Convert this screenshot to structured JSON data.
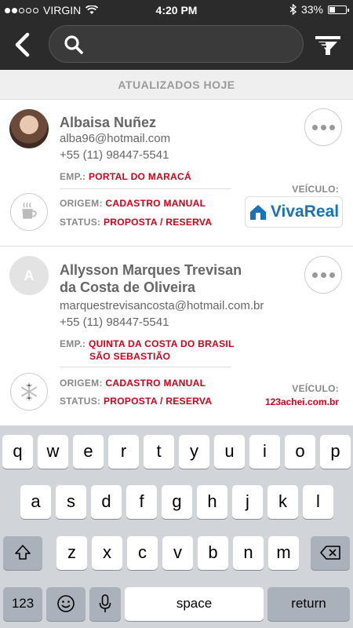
{
  "status_bar": {
    "carrier": "VIRGIN",
    "time": "4:20 PM",
    "battery": "33%",
    "battery_level": 0.33
  },
  "nav": {
    "search_placeholder": "",
    "search_value": ""
  },
  "section_title": "ATUALIZADOS HOJE",
  "leads": [
    {
      "name_line1": "Albaisa Nuñez",
      "name_line2": "",
      "email": "alba96@hotmail.com",
      "phone": "+55 (11) 98447-5541",
      "emp_label": "EMP.:",
      "emp_value_line1": "PORTAL DO MARACÁ",
      "emp_value_line2": "",
      "origem_label": "ORIGEM:",
      "origem_value": "CADASTRO MANUAL",
      "status_label": "STATUS:",
      "status_value": "PROPOSTA / RESERVA",
      "veiculo_label": "VEÍCULO:",
      "veiculo_value": "VivaReal",
      "type_icon": "coffee-icon"
    },
    {
      "initial": "A",
      "name_line1": "Allysson Marques Trevisan",
      "name_line2": "da Costa de Oliveira",
      "email": "marquestrevisancosta@hotmail.com.br",
      "phone": "+55 (11) 98447-5541",
      "emp_label": "EMP.:",
      "emp_value_line1": "QUINTA DA COSTA DO BRASIL",
      "emp_value_line2": "SÃO SEBASTIÃO",
      "origem_label": "ORIGEM:",
      "origem_value": "CADASTRO MANUAL",
      "status_label": "STATUS:",
      "status_value": "PROPOSTA / RESERVA",
      "veiculo_label": "VEÍCULO:",
      "veiculo_value": "123achei.com.br",
      "type_icon": "snowflake-icon"
    }
  ],
  "keyboard": {
    "row1": [
      "q",
      "w",
      "e",
      "r",
      "t",
      "y",
      "u",
      "i",
      "o",
      "p"
    ],
    "row2": [
      "a",
      "s",
      "d",
      "f",
      "g",
      "h",
      "j",
      "k",
      "l"
    ],
    "row3": [
      "z",
      "x",
      "c",
      "v",
      "b",
      "n",
      "m"
    ],
    "numbers_label": "123",
    "space_label": "space",
    "return_label": "return"
  },
  "colors": {
    "accent_red": "#d0021b",
    "topbar": "#2b2b2b",
    "vivareal_blue": "#1a73b8"
  }
}
